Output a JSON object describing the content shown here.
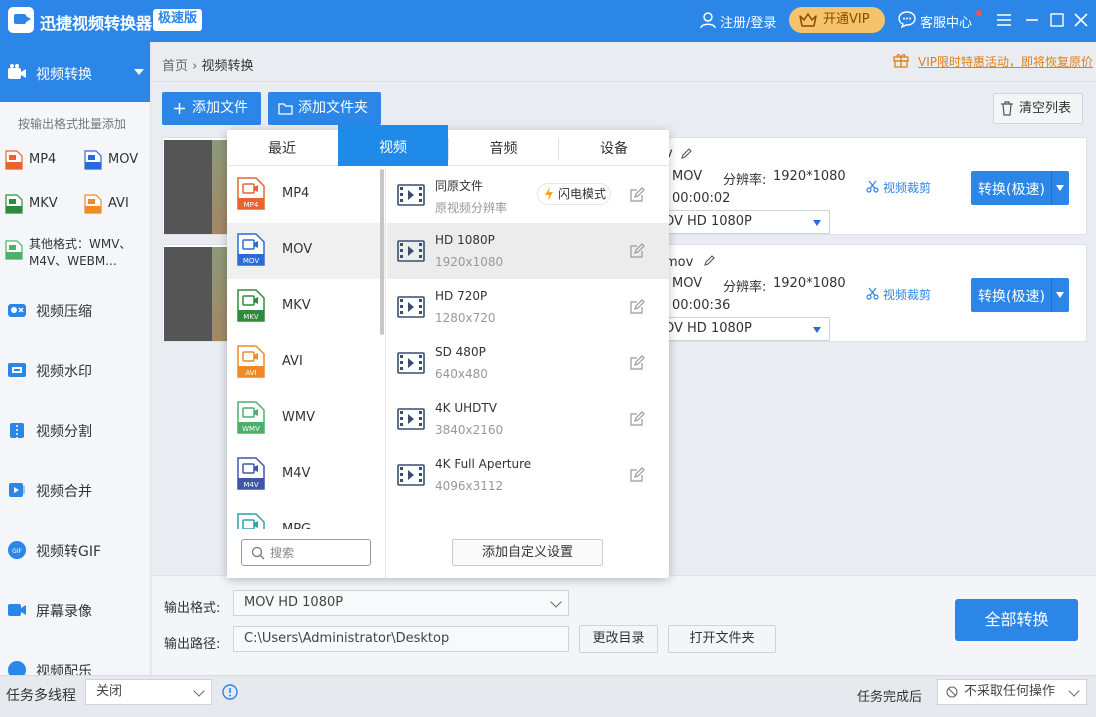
{
  "app": {
    "title": "迅捷视频转换器",
    "edition": "极速版"
  },
  "header": {
    "login": "注册/登录",
    "vip": "开通VIP",
    "service": "客服中心"
  },
  "sidebar": {
    "active_label": "视频转换",
    "batch_hint": "按输出格式批量添加",
    "formats": [
      "MP4",
      "MOV",
      "MKV",
      "AVI"
    ],
    "other_formats": "其他格式：WMV、M4V、WEBM...",
    "items": [
      "视频压缩",
      "视频水印",
      "视频分割",
      "视频合并",
      "视频转GIF",
      "屏幕录像",
      "视频配乐"
    ]
  },
  "breadcrumb": {
    "home": "首页",
    "current": "视频转换"
  },
  "promo": "VIP限时特惠活动，即将恢复原价",
  "toolbar": {
    "add_file": "添加文件",
    "add_folder": "添加文件夹",
    "clear_list": "清空列表"
  },
  "files": [
    {
      "name": "v",
      "format": "MOV",
      "resolution_label": "分辨率:",
      "resolution": "1920*1080",
      "duration": "00:00:02",
      "output": "OV  HD 1080P",
      "trim": "视频裁剪",
      "convert": "转换(极速)"
    },
    {
      "name": "mov",
      "format": "MOV",
      "resolution_label": "分辨率:",
      "resolution": "1920*1080",
      "duration": "00:00:36",
      "output": "OV  HD 1080P",
      "trim": "视频裁剪",
      "convert": "转换(极速)"
    }
  ],
  "format_panel": {
    "tabs": [
      "最近",
      "视频",
      "音频",
      "设备"
    ],
    "active_tab": 1,
    "formats": [
      {
        "name": "MP4",
        "color": "#e8632e"
      },
      {
        "name": "MOV",
        "color": "#2b6bd8"
      },
      {
        "name": "MKV",
        "color": "#2e8b3d"
      },
      {
        "name": "AVI",
        "color": "#f08a24"
      },
      {
        "name": "WMV",
        "color": "#4caf6a"
      },
      {
        "name": "M4V",
        "color": "#3f56a8"
      },
      {
        "name": "MPG",
        "color": "#2ba3a3"
      }
    ],
    "selected_format": 1,
    "search_placeholder": "搜索",
    "resolutions": [
      {
        "name": "同原文件",
        "sub": "原视频分辨率"
      },
      {
        "name": "HD 1080P",
        "sub": "1920x1080"
      },
      {
        "name": "HD 720P",
        "sub": "1280x720"
      },
      {
        "name": "SD 480P",
        "sub": "640x480"
      },
      {
        "name": "4K UHDTV",
        "sub": "3840x2160"
      },
      {
        "name": "4K Full Aperture",
        "sub": "4096x3112"
      }
    ],
    "selected_resolution": 1,
    "flash_mode": "闪电模式",
    "custom_settings": "添加自定义设置"
  },
  "output": {
    "format_label": "输出格式:",
    "format_value": "MOV  HD 1080P",
    "path_label": "输出路径:",
    "path_value": "C:\\Users\\Administrator\\Desktop",
    "change_dir": "更改目录",
    "open_folder": "打开文件夹",
    "convert_all": "全部转换"
  },
  "status": {
    "multithread_label": "任务多线程",
    "multithread_value": "关闭",
    "after_label": "任务完成后",
    "after_value": "不采取任何操作"
  },
  "colors": {
    "primary": "#2b86e8",
    "vip": "#f5c36b",
    "promo": "#e0801a"
  }
}
